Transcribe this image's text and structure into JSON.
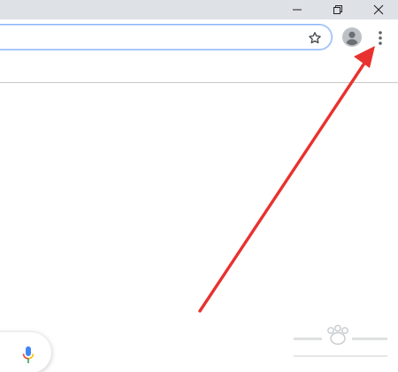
{
  "titlebar": {
    "minimize_icon": "minimize-icon",
    "restore_icon": "restore-icon",
    "close_icon": "close-icon"
  },
  "omnibox": {
    "value": "",
    "bookmark_icon": "star-icon"
  },
  "toolbar": {
    "profile_icon": "profile-avatar-icon",
    "menu_icon": "vertical-dots-icon"
  },
  "search": {
    "voice_icon": "microphone-icon"
  },
  "annotation": {
    "arrow_color": "#e8322f",
    "arrow_target": "menu-button"
  },
  "colors": {
    "titlebar": "#dee1e6",
    "omnibox_border": "#8ab4f8",
    "icon": "#5f6368",
    "mic_blue": "#4285f4",
    "mic_red": "#ea4335",
    "mic_yellow": "#fbbc04",
    "mic_green": "#34a853"
  }
}
